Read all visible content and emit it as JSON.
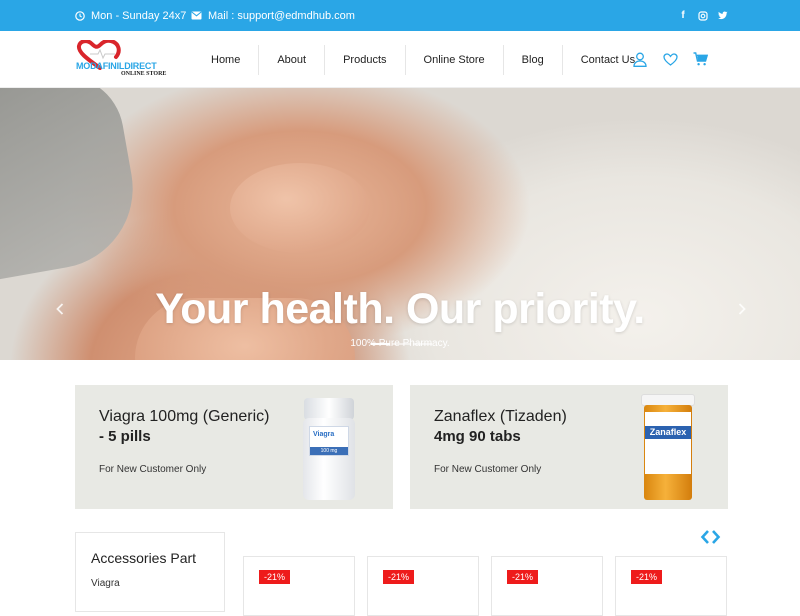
{
  "topbar": {
    "hours": "Mon - Sunday 24x7",
    "email": "Mail : support@edmdhub.com",
    "social": [
      "facebook-icon",
      "instagram-icon",
      "twitter-icon"
    ]
  },
  "logo": {
    "brand": "MODAFINILDIRECT",
    "tagline": "ONLINE STORE"
  },
  "nav": {
    "items": [
      "Home",
      "About",
      "Products",
      "Online Store",
      "Blog",
      "Contact Us"
    ]
  },
  "hero": {
    "title": "Your health. Our priority.",
    "subtitle": "100% Pure Pharmacy.",
    "slides": 3,
    "active_slide": 1
  },
  "promos": [
    {
      "name": "Viagra 100mg (Generic)",
      "qty": "- 5 pills",
      "cta": "For New Customer Only",
      "bottle_label": "Viagra",
      "bottle_band": "100 mg"
    },
    {
      "name": "Zanaflex (Tizaden)",
      "qty": "4mg 90 tabs",
      "cta": "For New Customer Only",
      "bottle_label": "Zanaflex"
    }
  ],
  "sidebar": {
    "heading": "Accessories Part",
    "items": [
      "Viagra"
    ]
  },
  "products": {
    "badges": [
      "-21%",
      "-21%",
      "-21%",
      "-21%"
    ]
  },
  "colors": {
    "accent": "#2aa6e6",
    "badge": "#ee1b1b",
    "promo_bg": "#e8e9e4"
  }
}
